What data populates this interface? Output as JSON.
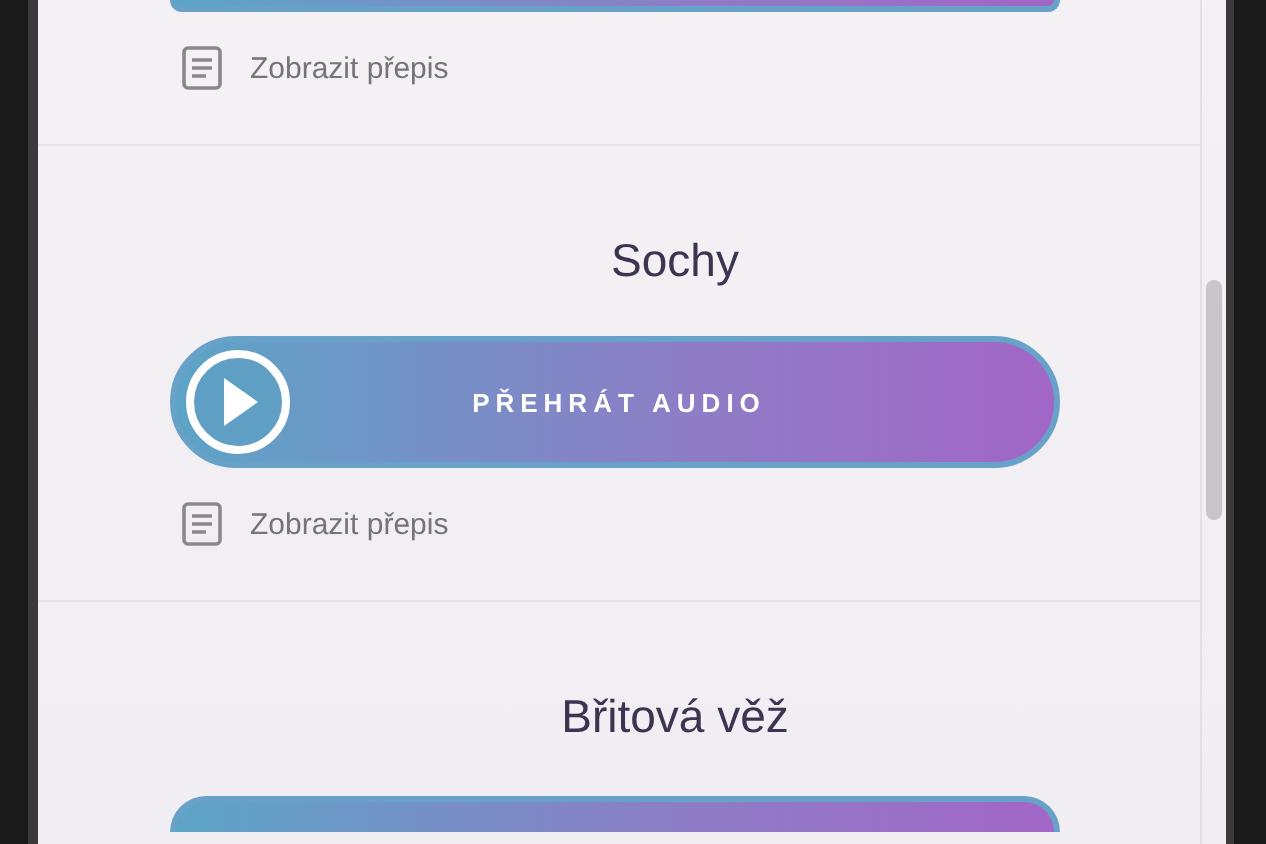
{
  "sections": [
    {
      "transcript": "Zobrazit přepis"
    },
    {
      "title": "Sochy",
      "button_label": "PŘEHRÁT AUDIO",
      "transcript": "Zobrazit přepis"
    },
    {
      "title": "Břitová věž"
    }
  ]
}
